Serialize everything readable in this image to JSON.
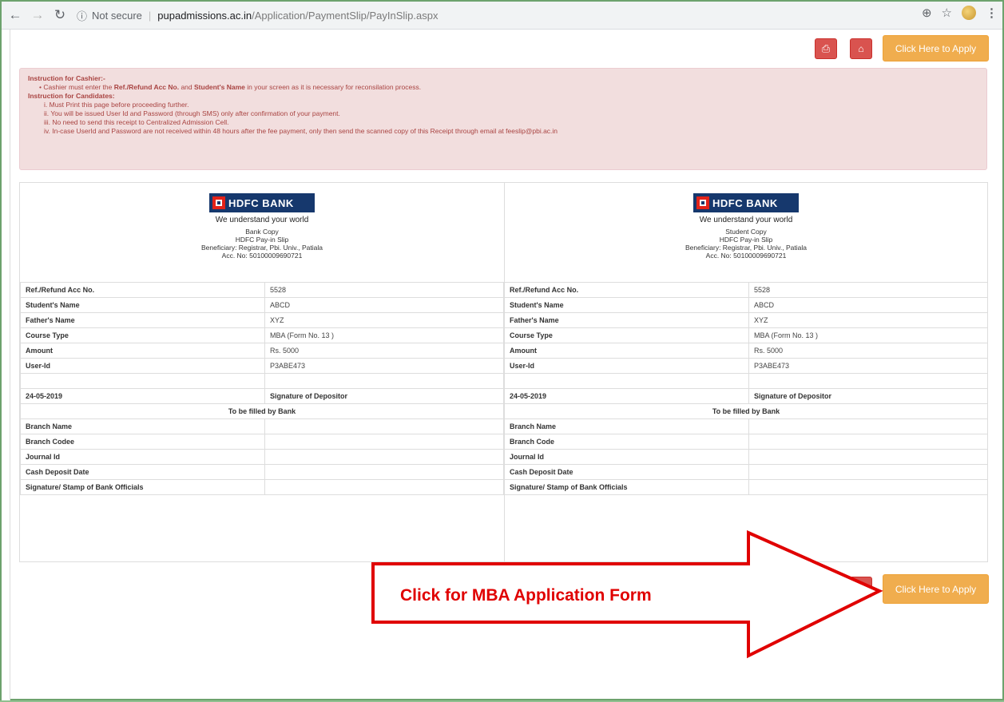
{
  "browser": {
    "security_label": "Not secure",
    "host": "pupadmissions.ac.in",
    "path": "/Application/PaymentSlip/PayInSlip.aspx"
  },
  "toolbar": {
    "apply_label": "Click Here to Apply"
  },
  "instructions": {
    "cashier_heading": "Instruction for Cashier:-",
    "cashier_line_pre": "Cashier must enter the ",
    "cashier_line_b1": "Ref./Refund Acc No.",
    "cashier_line_mid": " and ",
    "cashier_line_b2": "Student's Name",
    "cashier_line_post": " in your screen as it is necessary for reconsilation process.",
    "candidates_heading": "Instruction for Candidates:",
    "candidate_lines": [
      "i. Must Print this page before proceeding further.",
      "ii. You will be issued User Id and Password (through SMS) only after confirmation of your payment.",
      "iii. No need to send this receipt to Centralized Admission Cell.",
      "iv. In-case UserId and Password are not received within 48 hours after the fee payment, only then send the scanned copy of this Receipt through email at feeslip@pbi.ac.in"
    ]
  },
  "bank": {
    "name": "HDFC BANK",
    "tagline": "We understand your world"
  },
  "copies": [
    {
      "copy_label": "Bank Copy",
      "slip_label": "HDFC Pay-in Slip",
      "beneficiary": "Beneficiary: Registrar, Pbi. Univ., Patiala",
      "account": "Acc. No: 50100009690721",
      "rows": [
        {
          "label": "Ref./Refund Acc No.",
          "value": "5528"
        },
        {
          "label": "Student's Name",
          "value": "ABCD"
        },
        {
          "label": "Father's Name",
          "value": "XYZ"
        },
        {
          "label": "Course Type",
          "value": "MBA (Form No. 13 )"
        },
        {
          "label": "Amount",
          "value": "Rs. 5000"
        },
        {
          "label": "User-Id",
          "value": "P3ABE473"
        }
      ],
      "date": "24-05-2019",
      "signature": "Signature of Depositor",
      "bank_section": "To be filled by Bank",
      "bank_rows": [
        "Branch Name",
        "Branch Codee",
        "Journal Id",
        "Cash Deposit Date",
        "Signature/ Stamp of Bank Officials"
      ]
    },
    {
      "copy_label": "Student Copy",
      "slip_label": "HDFC Pay-in Slip",
      "beneficiary": "Beneficiary: Registrar, Pbi. Univ., Patiala",
      "account": "Acc. No: 50100009690721",
      "rows": [
        {
          "label": "Ref./Refund Acc No.",
          "value": "5528"
        },
        {
          "label": "Student's Name",
          "value": "ABCD"
        },
        {
          "label": "Father's Name",
          "value": "XYZ"
        },
        {
          "label": "Course Type",
          "value": "MBA (Form No. 13 )"
        },
        {
          "label": "Amount",
          "value": "Rs. 5000"
        },
        {
          "label": "User-Id",
          "value": "P3ABE473"
        }
      ],
      "date": "24-05-2019",
      "signature": "Signature of Depositor",
      "bank_section": "To be filled by Bank",
      "bank_rows": [
        "Branch Name",
        "Branch Code",
        "Journal Id",
        "Cash Deposit Date",
        "Signature/ Stamp of Bank Officials"
      ]
    }
  ],
  "annotation": {
    "label": "Click for MBA Application Form",
    "color": "#e00000"
  }
}
